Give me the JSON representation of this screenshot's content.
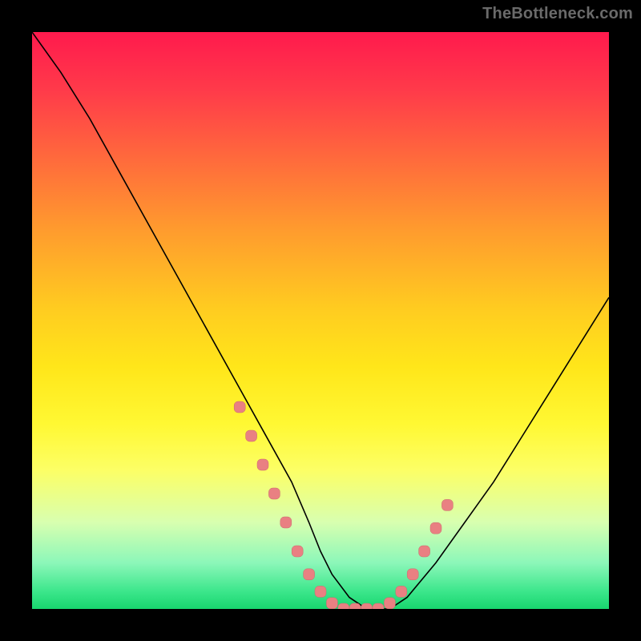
{
  "watermark": "TheBottleneck.com",
  "chart_data": {
    "type": "line",
    "title": "",
    "xlabel": "",
    "ylabel": "",
    "xlim": [
      0,
      100
    ],
    "ylim": [
      0,
      100
    ],
    "series": [
      {
        "name": "bottleneck-curve",
        "x": [
          0,
          5,
          10,
          15,
          20,
          25,
          30,
          35,
          40,
          45,
          48,
          50,
          52,
          55,
          58,
          60,
          62,
          65,
          70,
          75,
          80,
          85,
          90,
          95,
          100
        ],
        "values": [
          100,
          93,
          85,
          76,
          67,
          58,
          49,
          40,
          31,
          22,
          15,
          10,
          6,
          2,
          0,
          0,
          0,
          2,
          8,
          15,
          22,
          30,
          38,
          46,
          54
        ]
      }
    ],
    "markers": {
      "name": "highlight-cluster",
      "x": [
        36,
        38,
        40,
        42,
        44,
        46,
        48,
        50,
        52,
        54,
        56,
        58,
        60,
        62,
        64,
        66,
        68,
        70,
        72
      ],
      "values": [
        35,
        30,
        25,
        20,
        15,
        10,
        6,
        3,
        1,
        0,
        0,
        0,
        0,
        1,
        3,
        6,
        10,
        14,
        18
      ]
    },
    "gradient_stops": [
      {
        "pos": 0.0,
        "color": "#ff1a4d"
      },
      {
        "pos": 0.5,
        "color": "#ffe61a"
      },
      {
        "pos": 0.78,
        "color": "#fcff66"
      },
      {
        "pos": 0.92,
        "color": "#8cf7b9"
      },
      {
        "pos": 1.0,
        "color": "#18d66e"
      }
    ]
  }
}
